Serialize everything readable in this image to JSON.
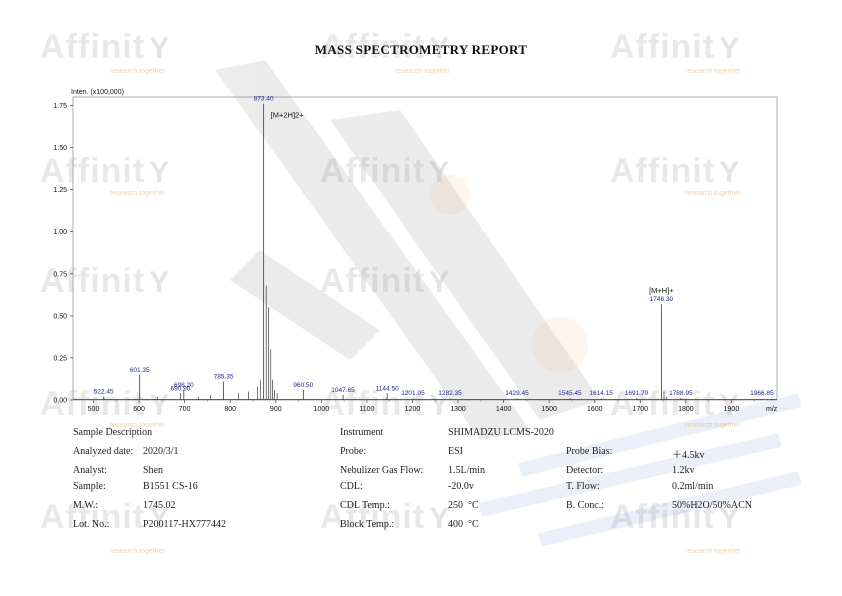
{
  "report_title": "MASS SPECTROMETRY REPORT",
  "watermark": {
    "brand": "Affinit",
    "tagline": "research together"
  },
  "chart_data": {
    "type": "line",
    "title": "",
    "ylabel": "Inten. (x100,000)",
    "xlabel": "m/z",
    "xlim": [
      455,
      2000
    ],
    "ylim": [
      0,
      1.8
    ],
    "x_ticks": [
      500,
      600,
      700,
      800,
      900,
      1000,
      1100,
      1200,
      1300,
      1400,
      1500,
      1600,
      1700,
      1800,
      1900
    ],
    "y_ticks": [
      "0.00",
      "0.25",
      "0.50",
      "0.75",
      "1.00",
      "1.25",
      "1.50",
      "1.75"
    ],
    "y_tick_values": [
      0,
      0.25,
      0.5,
      0.75,
      1.0,
      1.25,
      1.5,
      1.75
    ],
    "line_color": "#3a3a3a",
    "label_color": "#1f2a8a",
    "peaks": [
      {
        "mz": 522.45,
        "intensity": 0.02,
        "label": "522.45"
      },
      {
        "mz": 601.35,
        "intensity": 0.15,
        "label": "601.35"
      },
      {
        "mz": 690.9,
        "intensity": 0.04,
        "label": "690.90"
      },
      {
        "mz": 698.2,
        "intensity": 0.06,
        "label": "698.20"
      },
      {
        "mz": 785.35,
        "intensity": 0.11,
        "label": "785.35"
      },
      {
        "mz": 873.4,
        "intensity": 1.76,
        "label": "873.40"
      },
      {
        "mz": 960.5,
        "intensity": 0.06,
        "label": "960.50"
      },
      {
        "mz": 1047.65,
        "intensity": 0.03,
        "label": "1047.65"
      },
      {
        "mz": 1144.5,
        "intensity": 0.04,
        "label": "1144.50"
      },
      {
        "mz": 1201.05,
        "intensity": 0.01,
        "label": "1201.05"
      },
      {
        "mz": 1282.35,
        "intensity": 0.01,
        "label": "1282.35"
      },
      {
        "mz": 1429.45,
        "intensity": 0.01,
        "label": "1429.45"
      },
      {
        "mz": 1545.45,
        "intensity": 0.01,
        "label": "1545.45"
      },
      {
        "mz": 1614.15,
        "intensity": 0.01,
        "label": "1614.15"
      },
      {
        "mz": 1691.7,
        "intensity": 0.01,
        "label": "1691.70"
      },
      {
        "mz": 1746.3,
        "intensity": 0.57,
        "label": "1746.30"
      },
      {
        "mz": 1788.95,
        "intensity": 0.01,
        "label": "1788.95"
      },
      {
        "mz": 1966.85,
        "intensity": 0.005,
        "label": "1966.85"
      }
    ],
    "minor_peaks": [
      {
        "mz": 860,
        "intensity": 0.08
      },
      {
        "mz": 866,
        "intensity": 0.12
      },
      {
        "mz": 879,
        "intensity": 0.68
      },
      {
        "mz": 884,
        "intensity": 0.55
      },
      {
        "mz": 889,
        "intensity": 0.3
      },
      {
        "mz": 893,
        "intensity": 0.12
      },
      {
        "mz": 897,
        "intensity": 0.06
      },
      {
        "mz": 903,
        "intensity": 0.04
      },
      {
        "mz": 840,
        "intensity": 0.05
      },
      {
        "mz": 818,
        "intensity": 0.04
      },
      {
        "mz": 757,
        "intensity": 0.03
      },
      {
        "mz": 730,
        "intensity": 0.02
      },
      {
        "mz": 640,
        "intensity": 0.02
      },
      {
        "mz": 1752,
        "intensity": 0.05
      },
      {
        "mz": 1758,
        "intensity": 0.02
      }
    ],
    "annotations": [
      {
        "text": "[M+2H]2+",
        "mz": 873.4
      },
      {
        "text": "[M+H]+",
        "mz": 1746.3
      }
    ]
  },
  "sample_info": {
    "section_label": "Sample Description",
    "analyzed_date_label": "Analyzed date:",
    "analyzed_date": "2020/3/1",
    "analyst_label": "Analyst:",
    "analyst": "Shen",
    "sample_label": "Sample:",
    "sample": "B1551 CS-16",
    "mw_label": "M.W.:",
    "mw": "1745.02",
    "lot_label": "Lot. No.:",
    "lot": "P200117-HX777442"
  },
  "instrument_info": {
    "section_label": "Instrument",
    "instrument": "SHIMADZU LCMS-2020",
    "probe_label": "Probe:",
    "probe": "ESI",
    "nebulizer_label": "Nebulizer Gas Flow:",
    "nebulizer": "1.5L/min",
    "cdl_label": "CDL:",
    "cdl": "-20.0v",
    "cdl_temp_label": "CDL Temp.:",
    "cdl_temp": "250",
    "block_temp_label": "Block Temp.:",
    "block_temp": "400",
    "temp_unit": "°C"
  },
  "detector_info": {
    "probe_bias_label": "Probe Bias:",
    "probe_bias": "＋4.5kv",
    "detector_label": "Detector:",
    "detector": "1.2kv",
    "flow_label": "T. Flow:",
    "flow": "0.2ml/min",
    "conc_label": "B. Conc.:",
    "conc": "50%H2O/50%ACN"
  }
}
